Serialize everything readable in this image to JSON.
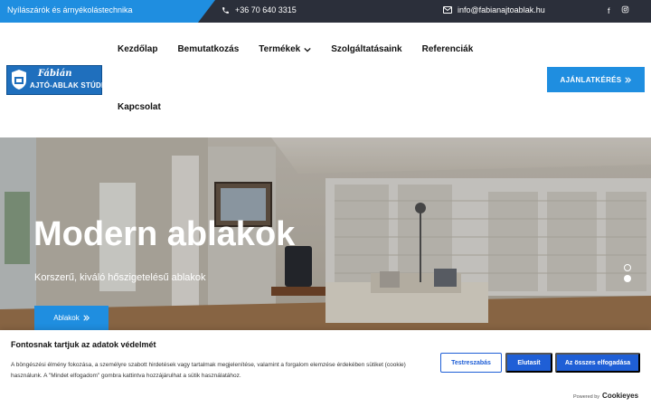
{
  "topbar": {
    "tagline": "Nyílászárók és árnyékolástechnika",
    "phone": "+36 70 640 3315",
    "email": "info@fabianajtoablak.hu",
    "social": [
      "facebook-icon",
      "instagram-icon"
    ]
  },
  "logo": {
    "line1": "Fábián",
    "line2": "AJTÓ-ABLAK STÚDIÓ"
  },
  "nav": {
    "items": [
      {
        "label": "Kezdőlap"
      },
      {
        "label": "Bemutatkozás"
      },
      {
        "label": "Termékek"
      },
      {
        "label": "Szolgáltatásaink"
      },
      {
        "label": "Referenciák"
      },
      {
        "label": "Kapcsolat"
      }
    ],
    "cta_label": "AJÁNLATKÉRÉS"
  },
  "hero": {
    "title": "Modern ablakok",
    "subtitle": "Korszerű, kiváló hőszigetelésű ablakok",
    "button_label": "Ablakok",
    "slides": 2,
    "active_slide": 2
  },
  "cookie": {
    "title": "Fontosnak tartjuk az adatok védelmét",
    "text": "A böngészési élmény fokozása, a személyre szabott hirdetések vagy tartalmak megjelenítése, valamint a forgalom elemzése érdekében sütiket (cookie) használunk. A \"Mindet elfogadom\" gombra kattintva hozzájárulhat a sütik használatához.",
    "customize_label": "Testreszabás",
    "reject_label": "Elutasít",
    "accept_label": "Az összes elfogadása",
    "powered_prefix": "Powered by",
    "powered_brand": "Cookieyes"
  },
  "colors": {
    "accent": "#1f8ee0",
    "topbar": "#2b2f3a",
    "cookie_button": "#1f5fd6"
  }
}
